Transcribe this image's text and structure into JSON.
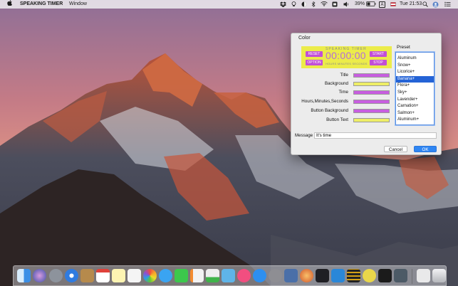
{
  "menubar": {
    "app_name": "SPEAKING TIMER",
    "menu_window": "Window",
    "battery": "39%",
    "input_source": "A",
    "clock": "Tue 21:53"
  },
  "dialog": {
    "title": "Color",
    "preview": {
      "title": "SPEAKING TIMER",
      "time": "00:00:00",
      "units": "HOURS MINUTES SECONDS",
      "reset": "RESET",
      "option": "OPTION",
      "start": "START",
      "stop": "STOP",
      "background_color": "#ecec4a",
      "button_color": "#c24fd6",
      "time_color": "#b56fd8"
    },
    "fields": [
      {
        "label": "Title",
        "color": "#c85ee0"
      },
      {
        "label": "Background",
        "color": "#eeee66"
      },
      {
        "label": "Time",
        "color": "#c85ee0"
      },
      {
        "label": "Hours,Minutes,Seconds",
        "color": "#c85ee0"
      },
      {
        "label": "Button Background",
        "color": "#c85ee0"
      },
      {
        "label": "Button Text",
        "color": "#eeee66"
      }
    ],
    "preset_label": "Preset",
    "presets": [
      "Aluminum",
      "Snow+",
      "Licorice+",
      "Banana+",
      "Flora+",
      "Sky+",
      "Lavender+",
      "Carnation+",
      "Salmon+",
      "Aluminum+"
    ],
    "preset_selected": "Banana+",
    "message_label": "Message",
    "message_value": "It's time",
    "cancel": "Cancel",
    "ok": "OK"
  }
}
